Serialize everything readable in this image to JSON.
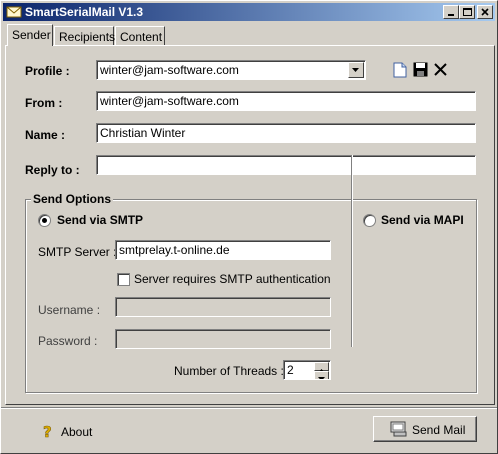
{
  "window": {
    "title": "SmartSerialMail V1.3",
    "app_icon": "envelope-icon",
    "minimize_icon": "minimize-icon",
    "maximize_icon": "maximize-icon",
    "close_icon": "close-icon"
  },
  "tabs": [
    {
      "label": "Sender",
      "active": true
    },
    {
      "label": "Recipients",
      "active": false
    },
    {
      "label": "Content",
      "active": false
    }
  ],
  "sender": {
    "profile_label": "Profile :",
    "profile_value": "winter@jam-software.com",
    "profile_actions": [
      "new-document-icon",
      "save-disk-icon",
      "delete-x-icon"
    ],
    "from_label": "From :",
    "from_value": "winter@jam-software.com",
    "name_label": "Name :",
    "name_value": "Christian Winter",
    "reply_label": "Reply to :",
    "reply_value": ""
  },
  "send_options": {
    "title": "Send Options",
    "smtp_label": "Send via SMTP",
    "smtp_selected": true,
    "mapi_label": "Send via MAPI",
    "mapi_selected": false,
    "server_label": "SMTP Server :",
    "server_value": "smtprelay.t-online.de",
    "auth_label": "Server requires SMTP authentication",
    "auth_checked": false,
    "username_label": "Username :",
    "username_value": "",
    "password_label": "Password :",
    "password_value": "",
    "threads_label": "Number of Threads :",
    "threads_value": "2"
  },
  "footer": {
    "about_label": "About",
    "about_icon": "help-question-icon",
    "send_label": "Send Mail",
    "send_icon": "send-mail-icon"
  }
}
